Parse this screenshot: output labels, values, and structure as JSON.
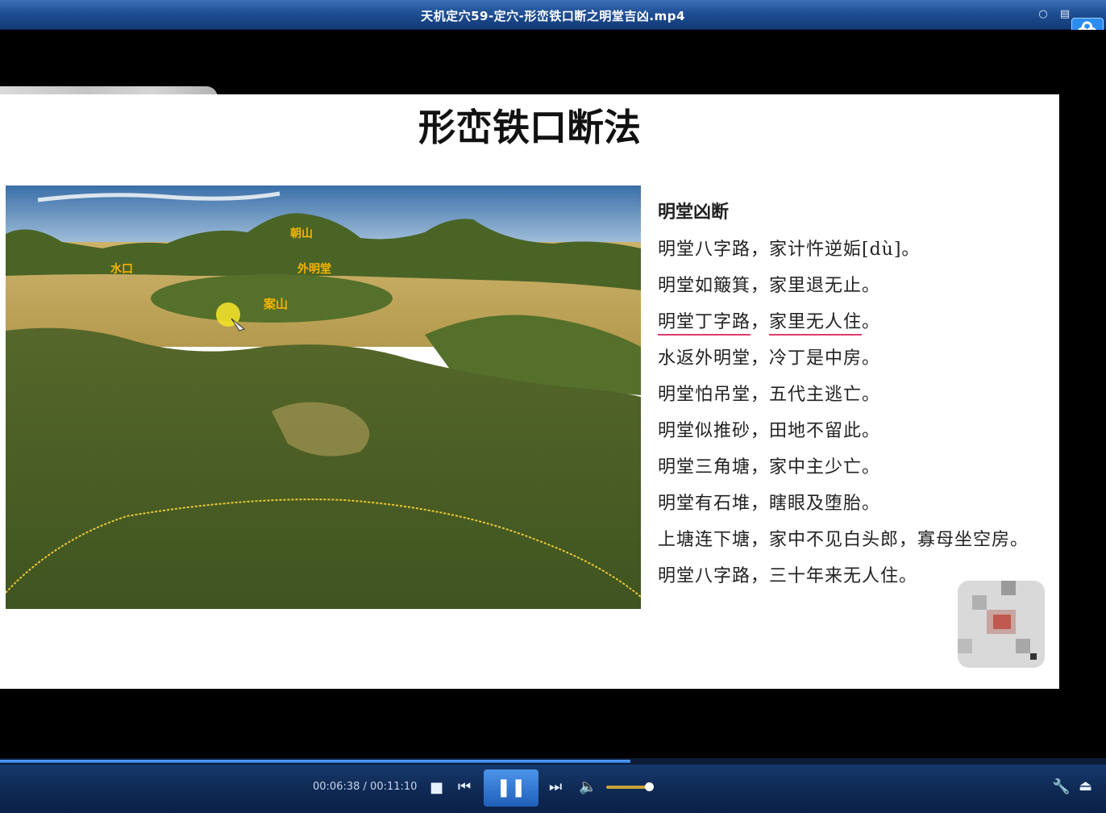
{
  "window": {
    "title": "天机定穴59-定穴-形峦铁口断之明堂吉凶.mp4"
  },
  "slide": {
    "title": "形峦铁口断法",
    "map_labels": {
      "chaoshan": "朝山",
      "shuikou": "水口",
      "waimingtang": "外明堂",
      "anshan": "案山"
    },
    "heading": "明堂凶断",
    "lines": [
      "明堂八字路，家计忤逆姤[dù]。",
      "明堂如簸箕，家里退无止。",
      "明堂丁字路，家里无人住。",
      "水返外明堂，冷丁是中房。",
      "明堂怕吊堂，五代主逃亡。",
      "明堂似推砂，田地不留此。",
      "明堂三角塘，家中主少亡。",
      "明堂有石堆，瞎眼及堕胎。",
      "上塘连下塘，家中不见白头郎，寡母坐空房。",
      "明堂八字路，三十年来无人住。"
    ],
    "underlined_line_parts": [
      "明堂丁字路",
      "家里无人住"
    ]
  },
  "player": {
    "time_current": "00:06:38",
    "time_separator": " / ",
    "time_total": "00:11:10",
    "progress": 0.57,
    "volume": 0.85
  },
  "icons": {
    "chat": "chat-bubble-icon",
    "playlist": "playlist-icon",
    "cloud": "baidu-cloud-icon",
    "stop": "stop-icon",
    "prev": "previous-icon",
    "pause": "pause-icon",
    "next": "next-icon",
    "volume": "volume-icon",
    "settings": "wrench-icon",
    "eject": "eject-icon"
  },
  "colors": {
    "titlebar": "#1f4f95",
    "accent": "#2c8cf0",
    "underline": "#e03a6a",
    "label": "#f5b400"
  }
}
